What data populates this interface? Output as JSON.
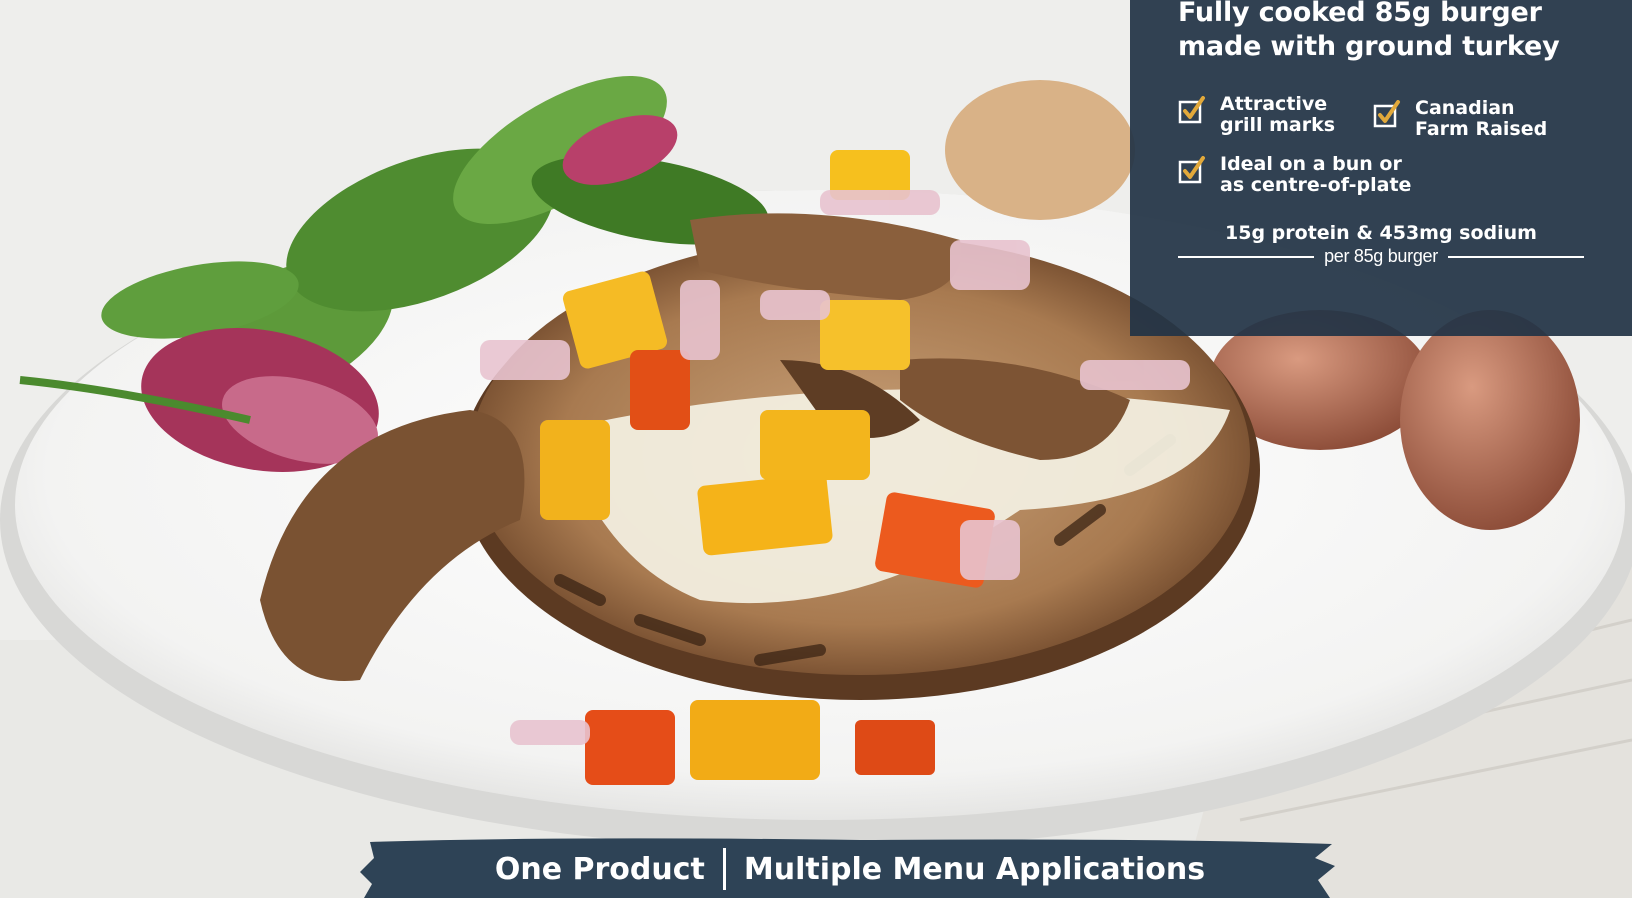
{
  "panel": {
    "headline_line1": "Fully cooked 85g burger",
    "headline_line2": "made with ground turkey",
    "features": [
      {
        "line1": "Attractive",
        "line2": "grill marks"
      },
      {
        "line1": "Canadian",
        "line2": "Farm Raised"
      },
      {
        "line1": "Ideal on a bun or",
        "line2": "as centre-of-plate"
      }
    ],
    "nutrition_main": "15g protein & 453mg sodium",
    "nutrition_sub": "per 85g burger"
  },
  "banner": {
    "left": "One Product",
    "right": "Multiple Menu Applications"
  },
  "colors": {
    "panel_bg": "#223446",
    "check_accent": "#e2a93b",
    "banner_bg": "#2e4356"
  },
  "icons": [
    "check-box-icon"
  ]
}
